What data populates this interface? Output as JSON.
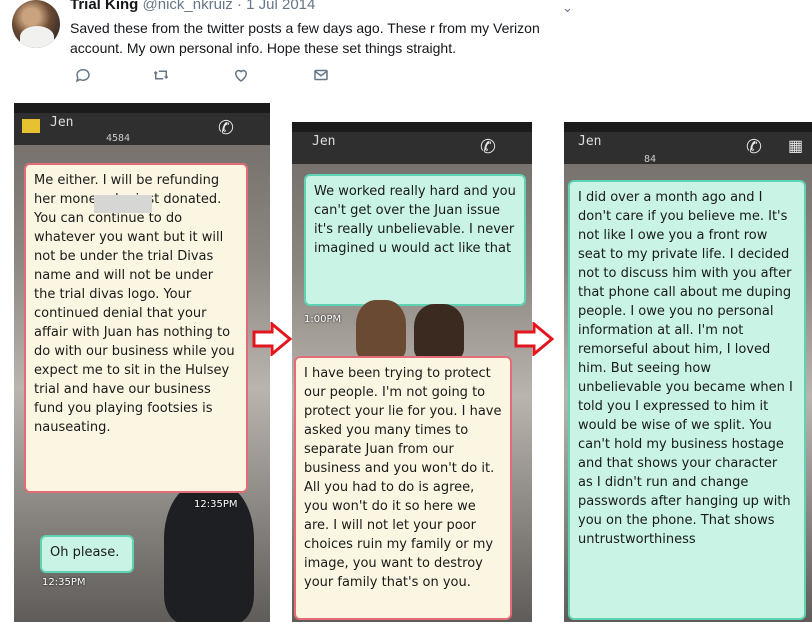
{
  "tweet": {
    "author_name": "Trial King",
    "handle": "@nick_nkruiz",
    "separator": "·",
    "date": "1 Jul 2014",
    "text": "Saved these from the twitter posts a few days ago. These r from my Verizon account.  My own personal info. Hope these set things straight.",
    "actions": [
      "reply-icon",
      "retweet-icon",
      "like-icon",
      "message-icon"
    ]
  },
  "screenshots": [
    {
      "contact": "Jen",
      "number_fragment": "4584",
      "bubbles": [
        {
          "type": "in",
          "text": "Me either. I will be refunding            her money she just donated. You can continue to do whatever you want but it will not be under the trial Divas name and will not be under the trial divas logo. Your continued denial that your affair with Juan has nothing to do with our business while you expect me to sit in the Hulsey trial and have our business fund you playing footsies is nauseating."
        },
        {
          "type": "out",
          "text": "Oh please."
        }
      ],
      "timestamps": [
        "12:35PM",
        "12:35PM"
      ]
    },
    {
      "contact": "Jen",
      "bubbles": [
        {
          "type": "out",
          "text": "We worked really hard and you can't get over the Juan issue it's really unbelievable. I never imagined u would act like that"
        },
        {
          "type": "in",
          "text": "I have been trying to protect our people. I'm not going to protect your lie for you. I have asked you many times to separate Juan from our business and you won't do it. All you had to do is agree, you won't do it so here we are. I will not let your poor choices ruin my family or my image, you want to destroy your family that's on you."
        }
      ],
      "timestamps": [
        "1:00PM"
      ]
    },
    {
      "contact": "Jen",
      "number_fragment": "84",
      "bubbles": [
        {
          "type": "out",
          "text": "I did over a month ago and I don't care if you believe me. It's not like I owe you a front row seat to my private life. I decided not to discuss him with you after that phone call about me duping people. I owe you no personal information at all. I'm not remorseful about him, I loved him. But seeing how unbelievable you became when I told you I expressed to him it would be wise of we split. You can't hold my business hostage and that shows your character as I didn't run and change passwords after hanging up with you on the phone. That shows untrustworthiness"
        }
      ]
    }
  ],
  "colors": {
    "incoming_border": "#e26d78",
    "outgoing_bg": "#c8f3e5",
    "arrow": "#e3161e"
  }
}
